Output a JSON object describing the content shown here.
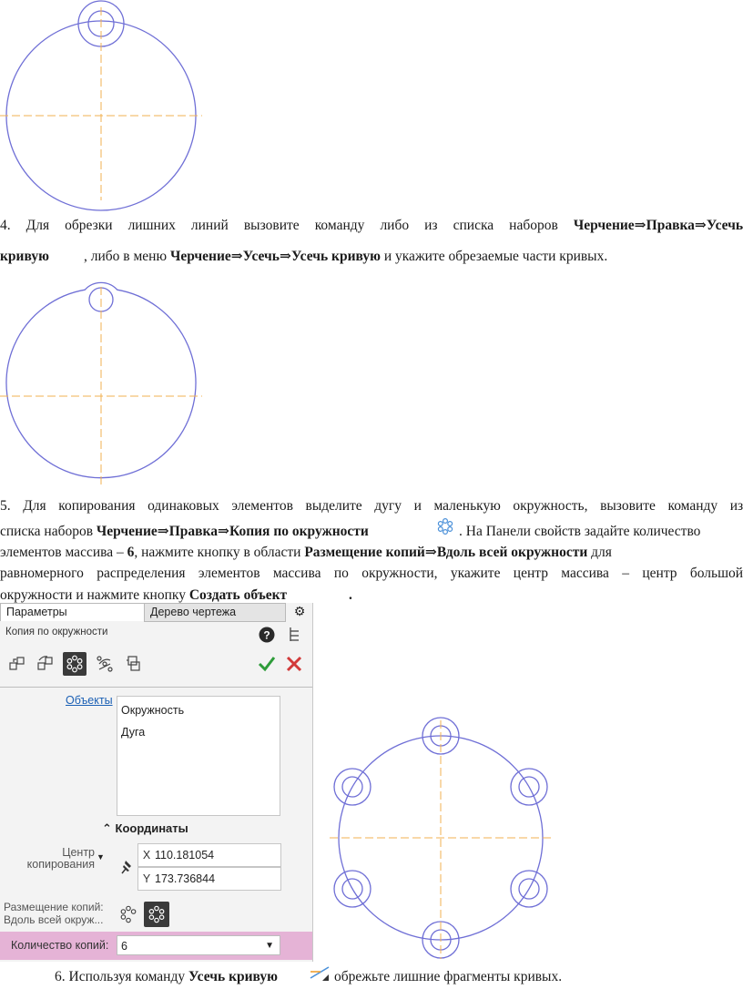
{
  "step4": {
    "num": "4.",
    "words_line1": [
      "Для",
      "обрезки",
      "лишних",
      "линий",
      "вызовите",
      "команду",
      "либо",
      "из",
      "списка",
      "наборов"
    ],
    "bold_line1": "Черчение⇒Правка⇒Усечь",
    "bold_kriv": "кривую",
    "text_a": ", либо в меню",
    "bold_menu": "Черчение⇒Усечь⇒Усечь кривую",
    "text_b": "и укажите обрезаемые части кривых."
  },
  "step5": {
    "words_line1": [
      "5.",
      "Для",
      "копирования",
      "одинаковых",
      "элементов",
      "выделите",
      "дугу",
      "и",
      "маленькую",
      "окружность,",
      "вызовите",
      "команду",
      "из"
    ],
    "line2_a": "списка наборов",
    "line2_bold": "Черчение⇒Правка⇒Копия по окружности",
    "line2_b": ". На Панели свойств задайте количество",
    "line3_a": "элементов массива –",
    "line3_bold6": "6",
    "line3_b": ", нажмите кнопку в области",
    "line3_bold": "Размещение копий⇒Вдоль всей окружности",
    "line3_c": "для",
    "words_line4": [
      "равномерного",
      "распределения",
      "элементов",
      "массива",
      "по",
      "окружности,",
      "укажите",
      "центр",
      "массива",
      "–",
      "центр",
      "большой"
    ],
    "line5_a": "окружности и нажмите кнопку",
    "line5_bold": "Создать объект",
    "line5_dot": "."
  },
  "panel": {
    "tab_params": "Параметры",
    "tab_tree": "Дерево чертежа",
    "title": "Копия по окружности",
    "objects_link": "Объекты",
    "objects": [
      "Окружность",
      "Дуга"
    ],
    "coords_header": "Координаты",
    "center_label_1": "Центр",
    "center_label_2": "копирования",
    "x_axis": "X",
    "x_value": "110.181054",
    "y_axis": "Y",
    "y_value": "173.736844",
    "placement_1": "Размещение копий:",
    "placement_2": "Вдоль всей окруж...",
    "count_label": "Количество копий:",
    "count_value": "6"
  },
  "step6": {
    "text_a": "6. Используя команду",
    "bold": "Усечь кривую",
    "text_b": "обрежьте лишние фрагменты кривых."
  },
  "colors": {
    "outline": "#6f6fd6",
    "centerline": "#f0b050",
    "accept": "#2e9c3a",
    "cancel": "#d23a3a",
    "count_row": "#e5b3d6"
  }
}
